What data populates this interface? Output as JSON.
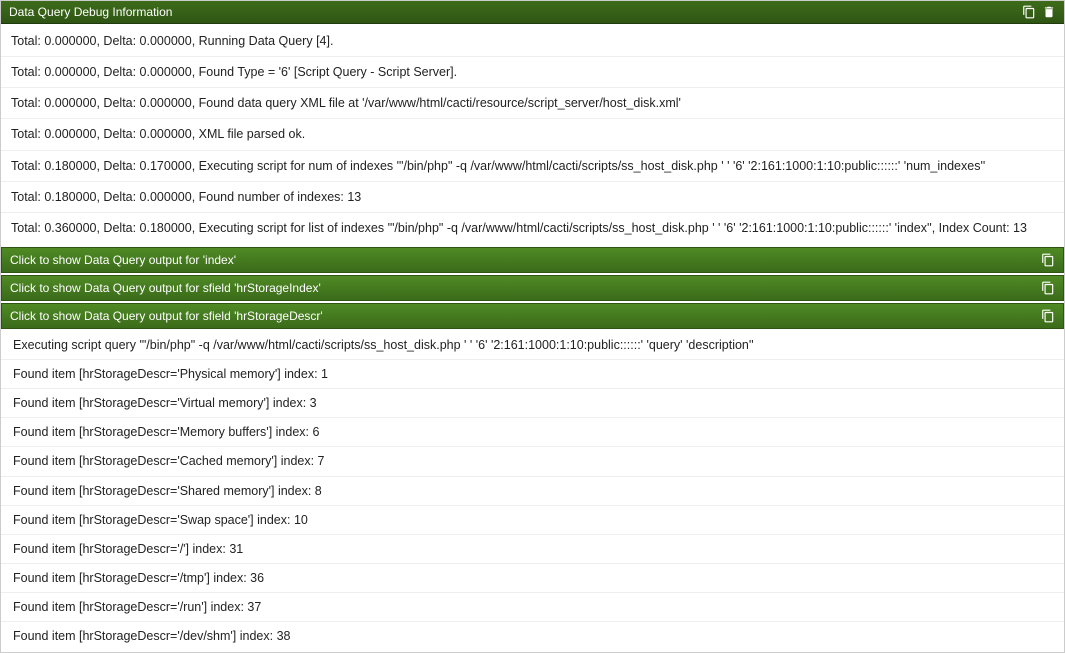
{
  "header": {
    "title": "Data Query Debug Information"
  },
  "log": [
    "Total: 0.000000, Delta: 0.000000, Running Data Query [4].",
    "Total: 0.000000, Delta: 0.000000, Found Type = '6' [Script Query - Script Server].",
    "Total: 0.000000, Delta: 0.000000, Found data query XML file at '/var/www/html/cacti/resource/script_server/host_disk.xml'",
    "Total: 0.000000, Delta: 0.000000, XML file parsed ok.",
    "Total: 0.180000, Delta: 0.170000, Executing script for num of indexes '\"/bin/php\" -q /var/www/html/cacti/scripts/ss_host_disk.php '                    ' '6' '2:161:1000:1:10:public::::::' 'num_indexes''",
    "Total: 0.180000, Delta: 0.000000, Found number of indexes: 13",
    "Total: 0.360000, Delta: 0.180000, Executing script for list of indexes '\"/bin/php\" -q /var/www/html/cacti/scripts/ss_host_disk.php '                    ' '6' '2:161:1000:1:10:public::::::' 'index'', Index Count: 13"
  ],
  "collapsers": [
    {
      "label": "Click to show Data Query output for 'index'"
    },
    {
      "label": "Click to show Data Query output for sfield 'hrStorageIndex'"
    },
    {
      "label": "Click to show Data Query output for sfield 'hrStorageDescr'"
    }
  ],
  "expanded": [
    "Executing script query '\"/bin/php\" -q /var/www/html/cacti/scripts/ss_host_disk.php '                    ' '6' '2:161:1000:1:10:public::::::' 'query' 'description''",
    "Found item [hrStorageDescr='Physical memory'] index: 1",
    "Found item [hrStorageDescr='Virtual memory'] index: 3",
    "Found item [hrStorageDescr='Memory buffers'] index: 6",
    "Found item [hrStorageDescr='Cached memory'] index: 7",
    "Found item [hrStorageDescr='Shared memory'] index: 8",
    "Found item [hrStorageDescr='Swap space'] index: 10",
    "Found item [hrStorageDescr='/'] index: 31",
    "Found item [hrStorageDescr='/tmp'] index: 36",
    "Found item [hrStorageDescr='/run'] index: 37",
    "Found item [hrStorageDescr='/dev/shm'] index: 38"
  ]
}
